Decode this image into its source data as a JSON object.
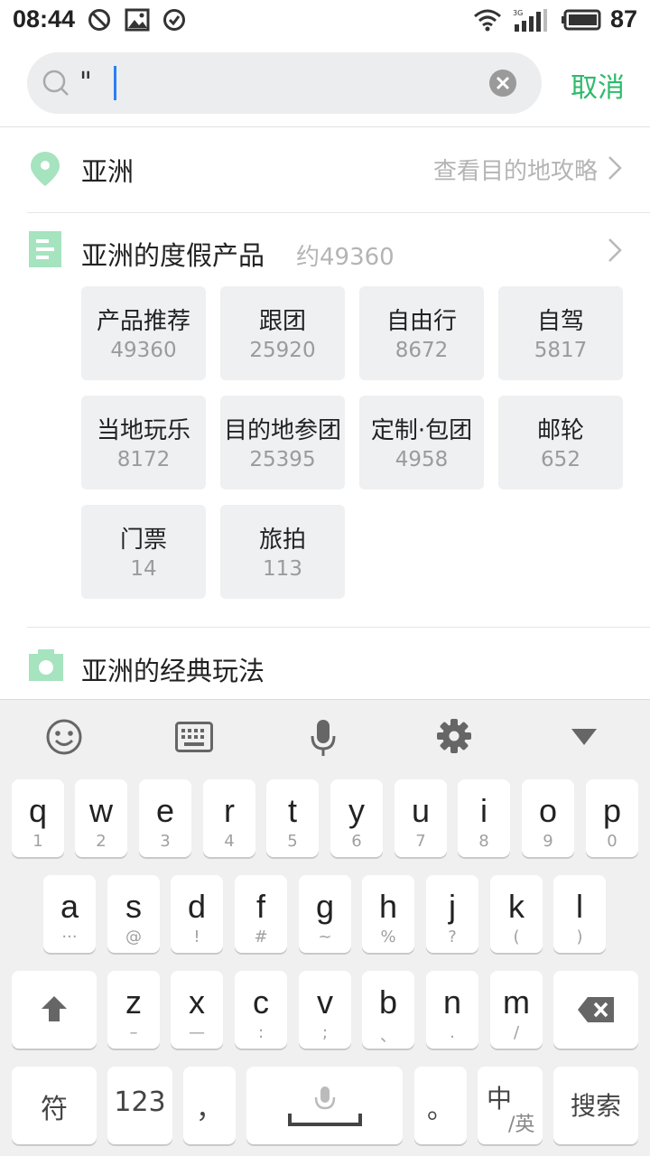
{
  "status_bar": {
    "time": "08:44",
    "battery": "87",
    "network": "3G"
  },
  "search": {
    "value": "\"",
    "cancel_label": "取消"
  },
  "destination": {
    "name": "亚洲",
    "guide_link": "查看目的地攻略"
  },
  "products": {
    "title": "亚洲的度假产品",
    "count": "约49360",
    "tiles": [
      {
        "label": "产品推荐",
        "count": "49360"
      },
      {
        "label": "跟团",
        "count": "25920"
      },
      {
        "label": "自由行",
        "count": "8672"
      },
      {
        "label": "自驾",
        "count": "5817"
      },
      {
        "label": "当地玩乐",
        "count": "8172"
      },
      {
        "label": "目的地参团",
        "count": "25395"
      },
      {
        "label": "定制·包团",
        "count": "4958"
      },
      {
        "label": "邮轮",
        "count": "652"
      },
      {
        "label": "门票",
        "count": "14"
      },
      {
        "label": "旅拍",
        "count": "113"
      }
    ]
  },
  "classic": {
    "title": "亚洲的经典玩法"
  },
  "keyboard": {
    "row1": [
      {
        "key": "q",
        "sub": "1"
      },
      {
        "key": "w",
        "sub": "2"
      },
      {
        "key": "e",
        "sub": "3"
      },
      {
        "key": "r",
        "sub": "4"
      },
      {
        "key": "t",
        "sub": "5"
      },
      {
        "key": "y",
        "sub": "6"
      },
      {
        "key": "u",
        "sub": "7"
      },
      {
        "key": "i",
        "sub": "8"
      },
      {
        "key": "o",
        "sub": "9"
      },
      {
        "key": "p",
        "sub": "0"
      }
    ],
    "row2": [
      {
        "key": "a",
        "sub": "···"
      },
      {
        "key": "s",
        "sub": "@"
      },
      {
        "key": "d",
        "sub": "!"
      },
      {
        "key": "f",
        "sub": "#"
      },
      {
        "key": "g",
        "sub": "~"
      },
      {
        "key": "h",
        "sub": "%"
      },
      {
        "key": "j",
        "sub": "?"
      },
      {
        "key": "k",
        "sub": "("
      },
      {
        "key": "l",
        "sub": ")"
      }
    ],
    "row3": [
      {
        "key": "z",
        "sub": "–"
      },
      {
        "key": "x",
        "sub": "—"
      },
      {
        "key": "c",
        "sub": ":"
      },
      {
        "key": "v",
        "sub": ";"
      },
      {
        "key": "b",
        "sub": "、"
      },
      {
        "key": "n",
        "sub": "."
      },
      {
        "key": "m",
        "sub": "/"
      }
    ],
    "symbols_label": "符",
    "numbers_label": "123",
    "comma_label": "，",
    "period_label": "。",
    "lang_main": "中",
    "lang_sub": "/英",
    "search_label": "搜索"
  }
}
